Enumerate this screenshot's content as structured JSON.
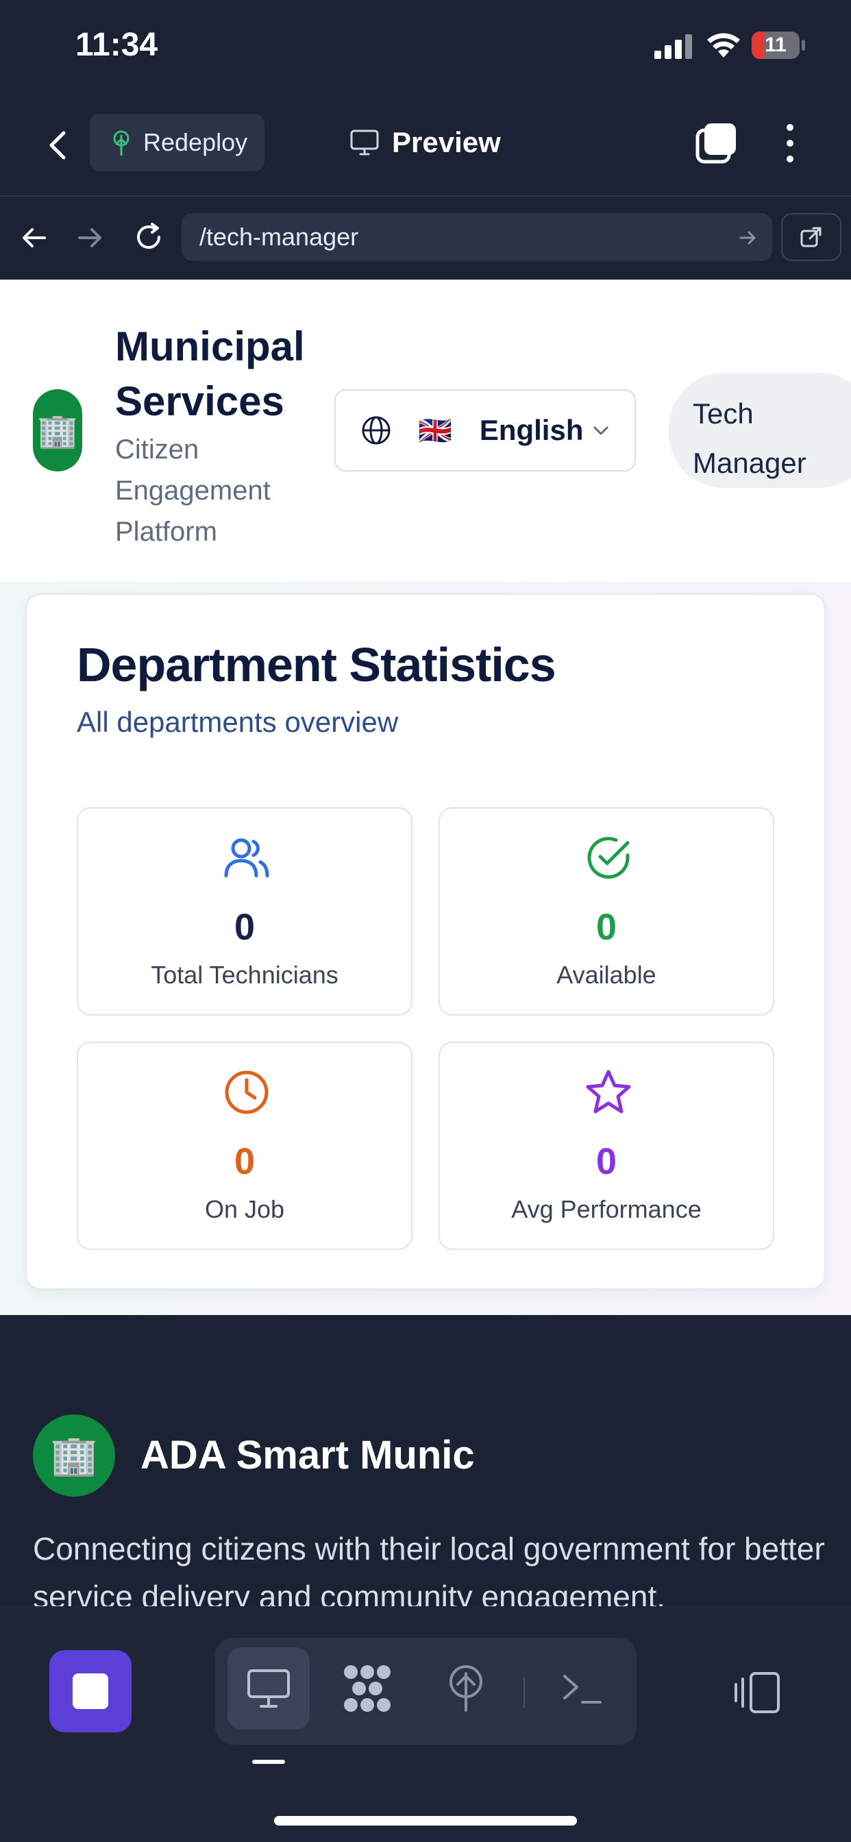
{
  "status_bar": {
    "time": "11:34",
    "battery": "11"
  },
  "toolbar": {
    "redeploy_label": "Redeploy",
    "preview_label": "Preview"
  },
  "browser": {
    "url": "/tech-manager"
  },
  "header": {
    "title": "Municipal Services",
    "subtitle": "Citizen Engagement Platform",
    "language": {
      "selected": "English",
      "flag": "🇬🇧"
    },
    "role": "Tech Manager",
    "logo_emoji": "🏢"
  },
  "department_stats": {
    "title": "Department Statistics",
    "subtitle": "All departments overview",
    "tiles": [
      {
        "icon": "users-icon",
        "value": "0",
        "label": "Total Technicians",
        "color": "#16224a",
        "icon_color": "#2f6fe0"
      },
      {
        "icon": "check-circle-icon",
        "value": "0",
        "label": "Available",
        "color": "#1f9d4a",
        "icon_color": "#1f9d4a"
      },
      {
        "icon": "clock-icon",
        "value": "0",
        "label": "On Job",
        "color": "#e2611a",
        "icon_color": "#e2611a"
      },
      {
        "icon": "star-icon",
        "value": "0",
        "label": "Avg Performance",
        "color": "#8a32e0",
        "icon_color": "#8a32e0"
      }
    ]
  },
  "footer": {
    "title": "ADA Smart Munic",
    "tagline": "Connecting citizens with their local government for better service delivery and community engagement."
  },
  "colors": {
    "chrome_bg": "#1b2233",
    "accent_purple": "#5b3fd6",
    "brand_green": "#0e8a3e"
  }
}
